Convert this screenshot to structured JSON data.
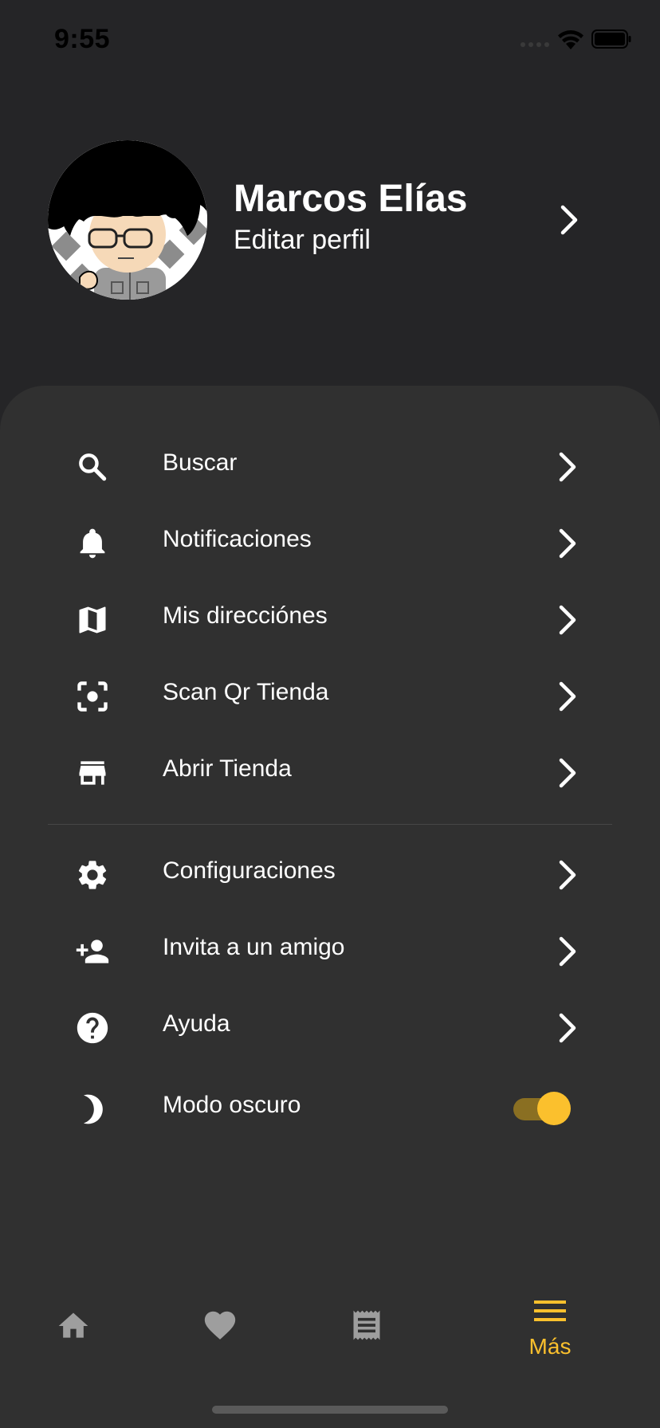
{
  "status_bar": {
    "time": "9:55"
  },
  "profile": {
    "name": "Marcos Elías",
    "subtitle": "Editar perfil"
  },
  "menu": {
    "items": [
      {
        "label": "Buscar",
        "icon": "search-icon"
      },
      {
        "label": "Notificaciones",
        "icon": "bell-icon"
      },
      {
        "label": "Mis direcciónes",
        "icon": "map-icon"
      },
      {
        "label": "Scan Qr Tienda",
        "icon": "scan-icon"
      },
      {
        "label": "Abrir Tienda",
        "icon": "store-icon"
      },
      {
        "label": "Configuraciones",
        "icon": "gear-icon"
      },
      {
        "label": "Invita a un amigo",
        "icon": "person-add-icon"
      },
      {
        "label": "Ayuda",
        "icon": "help-icon"
      }
    ],
    "dark_mode": {
      "label": "Modo oscuro",
      "icon": "moon-icon",
      "enabled": true
    }
  },
  "bottom_nav": {
    "items": [
      {
        "icon": "home-icon",
        "active": false
      },
      {
        "icon": "heart-icon",
        "active": false
      },
      {
        "icon": "receipt-icon",
        "active": false
      },
      {
        "icon": "menu-icon",
        "label": "Más",
        "active": true
      }
    ]
  },
  "colors": {
    "background": "#252527",
    "panel": "#303030",
    "accent": "#fbc02d",
    "inactive_icon": "#9e9e9e"
  }
}
